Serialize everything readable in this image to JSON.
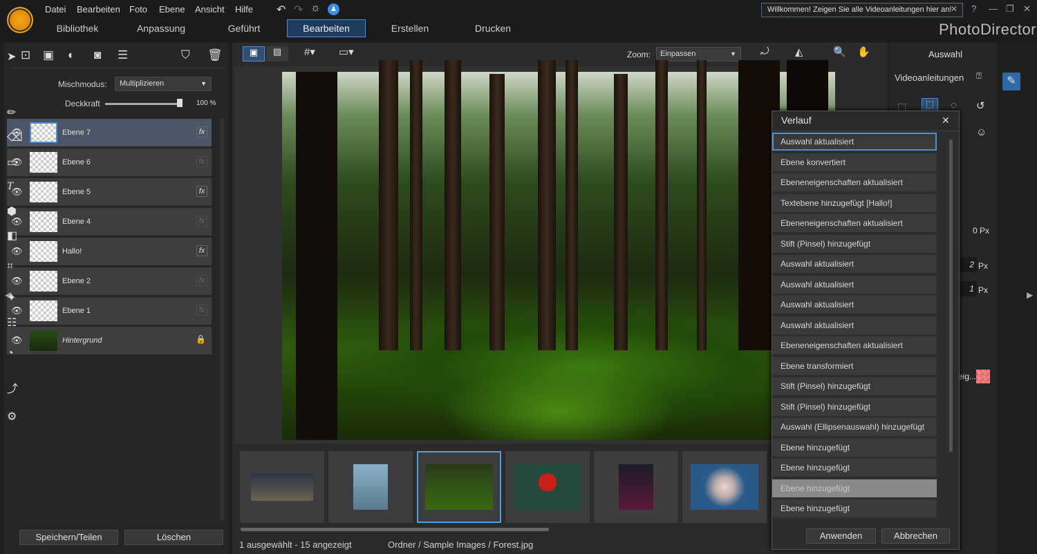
{
  "app": {
    "brand": "PhotoDirector",
    "welcome": "Willkommen! Zeigen Sie alle Videoanleitungen hier an!"
  },
  "menu": [
    "Datei",
    "Bearbeiten",
    "Foto",
    "Ebene",
    "Ansicht",
    "Hilfe"
  ],
  "tabs": [
    "Bibliothek",
    "Anpassung",
    "Geführt",
    "Bearbeiten",
    "Erstellen",
    "Drucken"
  ],
  "layers": {
    "blend_label": "Mischmodus:",
    "blend_value": "Multiplizieren",
    "opacity_label": "Deckkraft",
    "opacity_value": "100 %",
    "items": [
      {
        "name": "Ebene 7",
        "fx": true
      },
      {
        "name": "Ebene 6",
        "fx": false
      },
      {
        "name": "Ebene 5",
        "fx": true
      },
      {
        "name": "Ebene 4",
        "fx": false
      },
      {
        "name": "Hallo!",
        "fx": true
      },
      {
        "name": "Ebene 2",
        "fx": false
      },
      {
        "name": "Ebene 1",
        "fx": false
      },
      {
        "name": "Hintergrund",
        "fx": false
      }
    ],
    "save_label": "Speichern/Teilen",
    "delete_label": "Löschen"
  },
  "canvas": {
    "zoom_label": "Zoom:",
    "zoom_value": "Einpassen"
  },
  "status": {
    "selection": "1 ausgewählt - 15 angezeigt",
    "path": "Ordner / Sample Images / Forest.jpg"
  },
  "right": {
    "title": "Auswahl",
    "video": "Videoanleitungen",
    "px0": "0",
    "px2": "2",
    "px1": "1",
    "unit": "Px",
    "eig": "eig..."
  },
  "history": {
    "title": "Verlauf",
    "items": [
      "Auswahl aktualisiert",
      "Ebene konvertiert",
      "Ebeneneigenschaften aktualisiert",
      "Textebene hinzugefügt [Hallo!]",
      "Ebeneneigenschaften aktualisiert",
      "Stift (Pinsel) hinzugefügt",
      "Auswahl aktualisiert",
      "Auswahl aktualisiert",
      "Auswahl aktualisiert",
      "Auswahl aktualisiert",
      "Ebeneneigenschaften aktualisiert",
      "Ebene transformiert",
      "Stift (Pinsel) hinzugefügt",
      "Stift (Pinsel) hinzugefügt",
      "Auswahl (Ellipsenauswahl) hinzugefügt",
      "Ebene hinzugefügt",
      "Ebene hinzugefügt",
      "Ebene hinzugefügt",
      "Ebene hinzugefügt"
    ],
    "apply": "Anwenden",
    "cancel": "Abbrechen"
  }
}
